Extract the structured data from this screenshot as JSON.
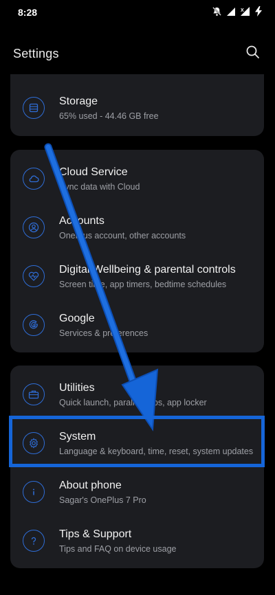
{
  "status_bar": {
    "time": "8:28"
  },
  "app_bar": {
    "title": "Settings"
  },
  "cards": {
    "storage": {
      "title": "Storage",
      "subtitle": "65% used - 44.46 GB free"
    },
    "cloud_service": {
      "title": "Cloud Service",
      "subtitle": "Sync data with Cloud"
    },
    "accounts": {
      "title": "Accounts",
      "subtitle": "OnePlus account, other accounts"
    },
    "digital_wellbeing": {
      "title": "Digital Wellbeing & parental controls",
      "subtitle": "Screen time, app timers, bedtime schedules"
    },
    "google": {
      "title": "Google",
      "subtitle": "Services & preferences"
    },
    "utilities": {
      "title": "Utilities",
      "subtitle": "Quick launch, parallel apps, app locker"
    },
    "system": {
      "title": "System",
      "subtitle": "Language & keyboard, time, reset, system updates"
    },
    "about_phone": {
      "title": "About phone",
      "subtitle": "Sagar's OnePlus 7 Pro"
    },
    "tips_support": {
      "title": "Tips & Support",
      "subtitle": "Tips and FAQ on device usage"
    }
  },
  "icons": {
    "status": [
      "mute-icon",
      "signal-icon",
      "signal-no-data-icon",
      "battery-charging-icon"
    ],
    "search": "search-icon"
  },
  "colors": {
    "background": "#000000",
    "card": "#1c1d21",
    "accent_icon": "#2f6ed8",
    "annotation": "#1565d8"
  }
}
